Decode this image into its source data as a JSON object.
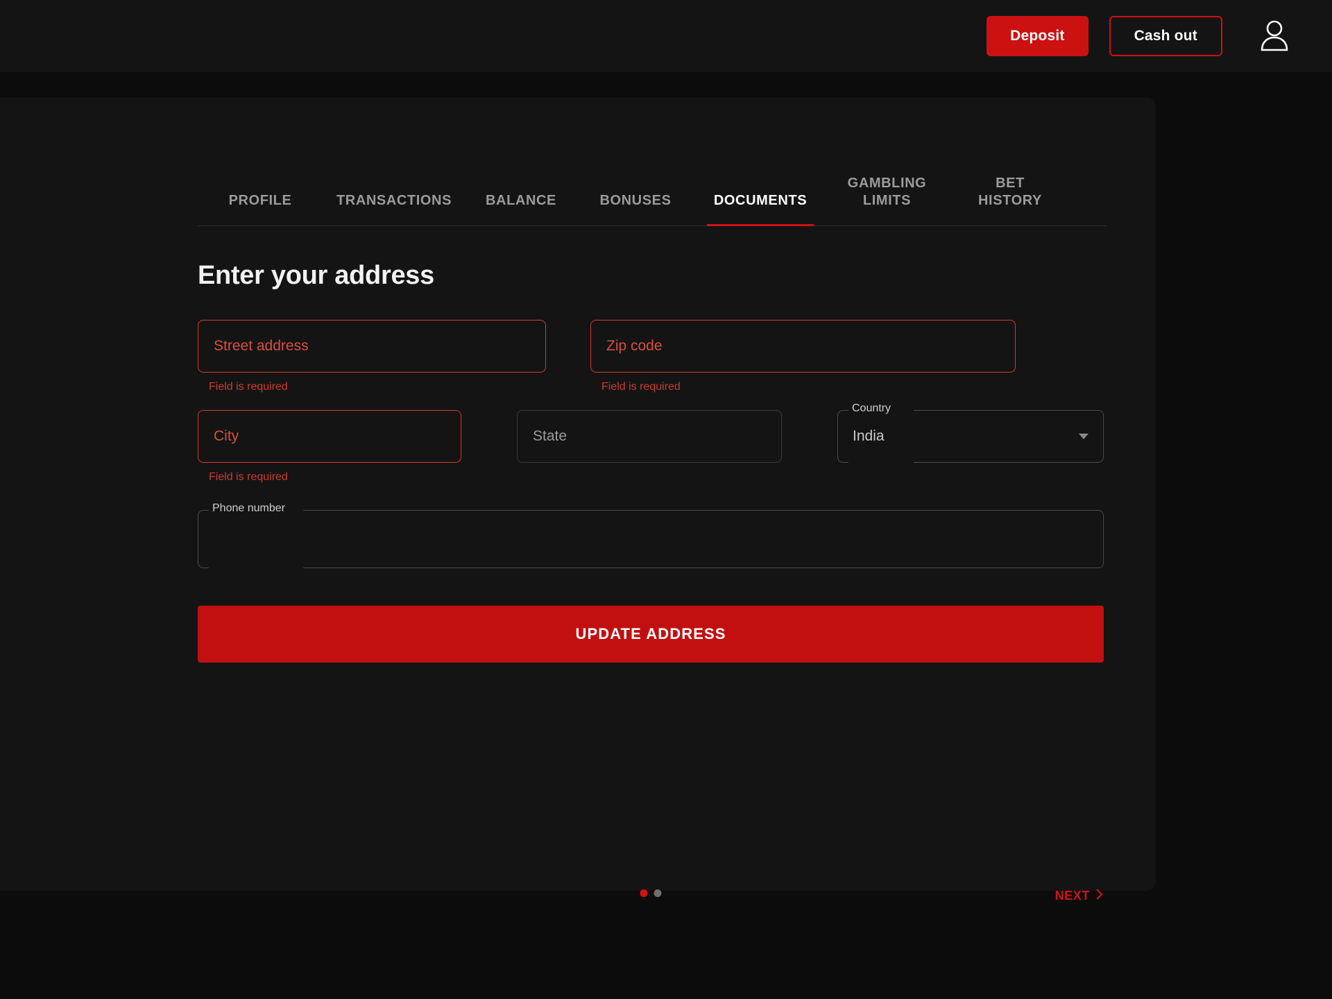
{
  "topbar": {
    "deposit_label": "Deposit",
    "cashout_label": "Cash out",
    "account_icon": "user-avatar-icon"
  },
  "theme": {
    "accent_red": "#cc1111",
    "error_red": "#d33b2e",
    "panel_bg": "#141414",
    "page_bg": "#0c0c0c",
    "muted_text": "#9b9b9b"
  },
  "tabs": [
    {
      "label": "PROFILE",
      "active": false
    },
    {
      "label": "TRANSACTIONS",
      "active": false
    },
    {
      "label": "BALANCE",
      "active": false
    },
    {
      "label": "BONUSES",
      "active": false
    },
    {
      "label": "DOCUMENTS",
      "active": true
    },
    {
      "label": "GAMBLING\nLIMITS",
      "active": false
    },
    {
      "label": "BET\nHISTORY",
      "active": false
    }
  ],
  "main": {
    "heading": "Enter your address",
    "fields": {
      "street": {
        "placeholder": "Street address",
        "value": "",
        "error": "Field is required"
      },
      "zip": {
        "placeholder": "Zip code",
        "value": "",
        "error": "Field is required"
      },
      "city": {
        "placeholder": "City",
        "value": "",
        "error": "Field is required"
      },
      "state": {
        "placeholder": "State",
        "value": ""
      },
      "country": {
        "label": "Country",
        "value": "India",
        "caret_icon": "chevron-down-icon"
      },
      "phone": {
        "label": "Phone number",
        "value": ""
      }
    },
    "submit_label": "UPDATE ADDRESS"
  },
  "pager": {
    "dots": [
      true,
      false
    ],
    "next_label": "NEXT",
    "next_icon": "chevron-right-icon"
  }
}
